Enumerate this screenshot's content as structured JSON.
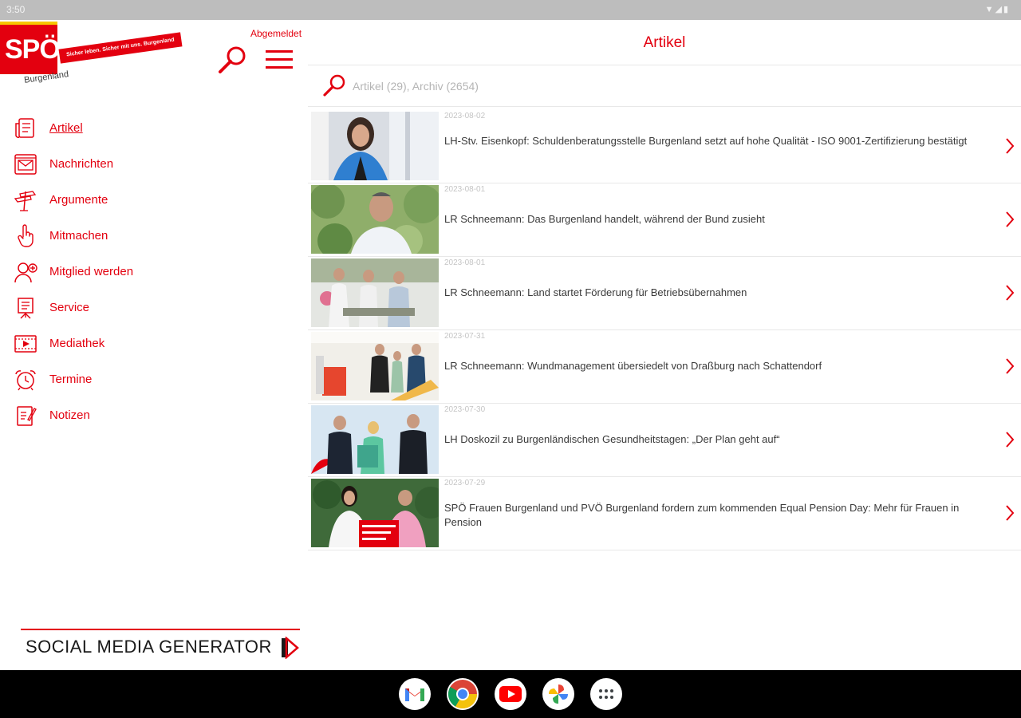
{
  "status": {
    "time": "3:50",
    "icons": "▼◢▮"
  },
  "brand": {
    "logo_text": "SPÖ",
    "banner_text": "Sicher leben. Sicher mit uns. Burgenland",
    "region": "Burgenland",
    "accent": "#e3000f",
    "stripe": "#f7c600"
  },
  "account": {
    "status": "Abgemeldet"
  },
  "nav": {
    "items": [
      {
        "label": "Artikel",
        "icon": "newspaper-icon",
        "active": true
      },
      {
        "label": "Nachrichten",
        "icon": "envelope-icon"
      },
      {
        "label": "Argumente",
        "icon": "signpost-icon"
      },
      {
        "label": "Mitmachen",
        "icon": "pointing-hand-icon"
      },
      {
        "label": "Mitglied werden",
        "icon": "add-person-icon"
      },
      {
        "label": "Service",
        "icon": "presentation-board-icon"
      },
      {
        "label": "Mediathek",
        "icon": "film-play-icon"
      },
      {
        "label": "Termine",
        "icon": "alarm-clock-icon"
      },
      {
        "label": "Notizen",
        "icon": "note-pencil-icon"
      }
    ]
  },
  "social": {
    "label": "SOCIAL MEDIA GENERATOR"
  },
  "main": {
    "title": "Artikel",
    "search_placeholder": "Artikel (29), Archiv (2654)"
  },
  "articles": [
    {
      "date": "2023-08-02",
      "title": "LH-Stv. Eisenkopf: Schuldenberatungsstelle Burgenland setzt auf hohe Qualität - ISO 9001-Zertifizierung bestätigt"
    },
    {
      "date": "2023-08-01",
      "title": "LR Schneemann: Das Burgenland handelt, während der Bund zusieht"
    },
    {
      "date": "2023-08-01",
      "title": "LR Schneemann: Land startet Förderung für Betriebsübernahmen"
    },
    {
      "date": "2023-07-31",
      "title": "LR Schneemann: Wundmanagement übersiedelt von Draßburg nach Schattendorf"
    },
    {
      "date": "2023-07-30",
      "title": "LH Doskozil zu Burgenländischen Gesundheitstagen: „Der Plan geht auf“"
    },
    {
      "date": "2023-07-29",
      "title": "SPÖ Frauen Burgenland und PVÖ Burgenland fordern zum kommenden Equal Pension Day: Mehr für Frauen in Pension"
    }
  ],
  "dock": [
    "gmail-icon",
    "chrome-icon",
    "youtube-icon",
    "photos-icon",
    "app-drawer-icon"
  ]
}
